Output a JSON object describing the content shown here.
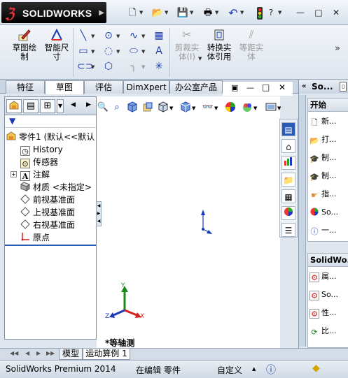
{
  "app": {
    "logo_name": "SOLIDWORKS",
    "window_buttons": {
      "help": "?",
      "minimize": "—",
      "restore": "□",
      "close": "✕"
    }
  },
  "ribbon": {
    "sketch_label": "草图绘\n制",
    "smart_dimension_label": "智能尺\n寸",
    "trim_label": "剪裁实\n体(I)",
    "convert_label": "转换实\n体引用",
    "offset_label": "等距实\n体"
  },
  "tabs": [
    "特征",
    "草图",
    "评估",
    "DimXpert",
    "办公室产品"
  ],
  "active_tab": "草图",
  "viewport_title_buttons": [
    "▣",
    "—",
    "□",
    "✕"
  ],
  "tree": {
    "root": "零件1 (默认<<默认",
    "items": [
      {
        "label": "History",
        "icon": "history-icon"
      },
      {
        "label": "传感器",
        "icon": "sensor-icon"
      },
      {
        "label": "注解",
        "icon": "annotation-icon",
        "expandable": true
      },
      {
        "label": "材质 <未指定>",
        "icon": "material-icon"
      },
      {
        "label": "前视基准面",
        "icon": "plane-icon"
      },
      {
        "label": "上视基准面",
        "icon": "plane-icon"
      },
      {
        "label": "右视基准面",
        "icon": "plane-icon"
      },
      {
        "label": "原点",
        "icon": "origin-icon"
      }
    ]
  },
  "viewport": {
    "orientation_label": "*等轴测",
    "triad_labels": {
      "x": "X",
      "y": "Y",
      "z": "Z"
    }
  },
  "bottom_tabs": [
    "模型",
    "运动算例 1"
  ],
  "status": {
    "product": "SolidWorks Premium 2014",
    "mode": "在编辑 零件",
    "custom": "自定义"
  },
  "taskpane": {
    "title": "So...",
    "section1": "开始",
    "section1_items": [
      "新...",
      "打...",
      "制...",
      "制...",
      "指...",
      "So...",
      "一..."
    ],
    "section2": "SolidWo...",
    "section2_items": [
      "属...",
      "So...",
      "性...",
      "比..."
    ]
  },
  "colors": {
    "accent_blue": "#2a5bb8",
    "triad_x": "#d22020",
    "triad_y": "#1a8a1a",
    "triad_z": "#1a3bb5"
  }
}
